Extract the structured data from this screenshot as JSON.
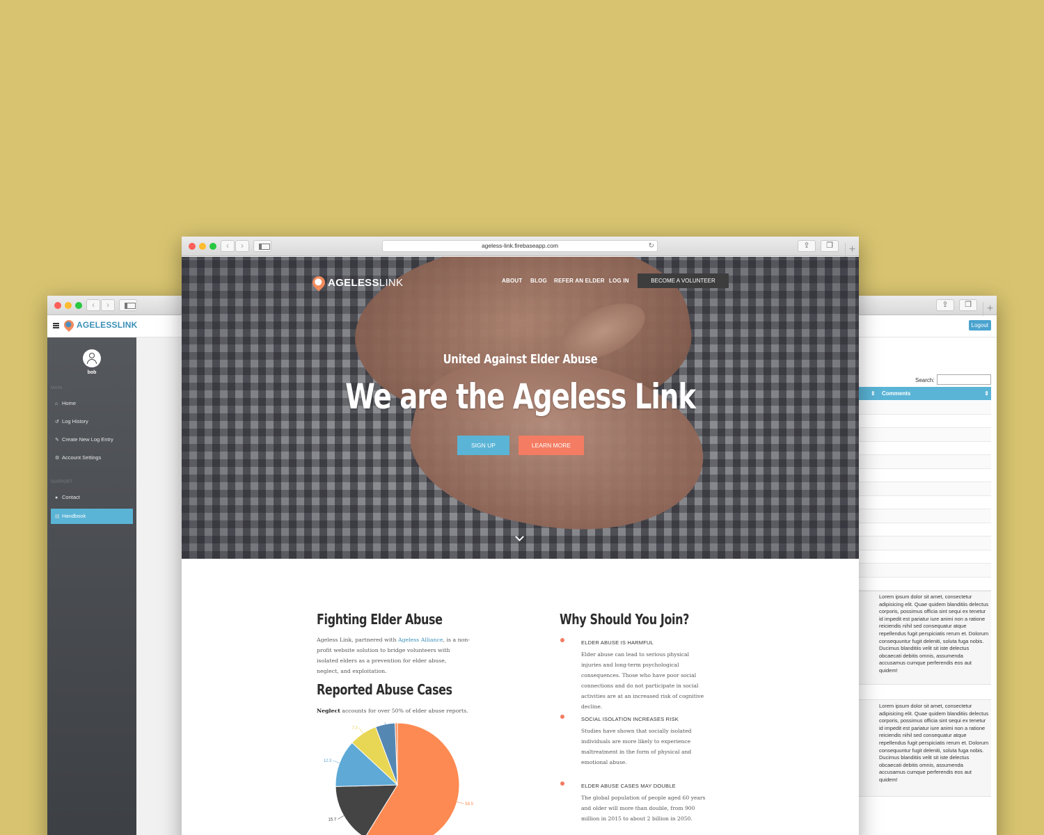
{
  "dashboard": {
    "logo_text": "AGELESSLINK",
    "username": "bob",
    "section_main": "MAIN",
    "section_support": "SUPPORT",
    "nav_main": [
      {
        "label": "Home",
        "icon": "home-icon"
      },
      {
        "label": "Log History",
        "icon": "history-icon"
      },
      {
        "label": "Create New Log Entry",
        "icon": "pencil-icon"
      },
      {
        "label": "Account Settings",
        "icon": "gears-icon"
      }
    ],
    "nav_support": [
      {
        "label": "Contact",
        "icon": "user-icon"
      },
      {
        "label": "Handbook",
        "icon": "book-icon",
        "active": true
      }
    ],
    "accent_color": "#5ab4d6"
  },
  "table_page": {
    "logout_label": "Logout",
    "search_label": "Search:",
    "column_header": "Comments",
    "comments": [
      "Lorem ipsum dolor sit amet, consectetur adipisicing elit. Quae quidem blanditiis delectus corporis, possimus officia sint sequi ex tenetur id impedit est pariatur iure animi non a ratione reiciendis nihil sed consequatur atque repellendus fugit perspiciatis rerum et. Dolorum consequuntur fugit deleniti, soluta fuga nobis. Ducimus blanditiis velit sit iste delectus obcaecati debitis omnis, assumenda accusamus cumque perferendis eos aut quidem!",
      "Lorem ipsum dolor sit amet, consectetur adipisicing elit. Quae quidem blanditiis delectus corporis, possimus officia sint sequi ex tenetur id impedit est pariatur iure animi non a ratione reiciendis nihil sed consequatur atque repellendus fugit perspiciatis rerum et. Dolorum consequuntur fugit deleniti, soluta fuga nobis. Ducimus blanditiis velit sit iste delectus obcaecati debitis omnis, assumenda accusamus cumque perferendis eos aut quidem!"
    ]
  },
  "browser": {
    "url": "ageless-link.firebaseapp.com"
  },
  "site": {
    "brand_bold": "AGELESS",
    "brand_thin": "LINK",
    "nav": [
      "ABOUT",
      "BLOG",
      "REFER AN ELDER",
      "LOG IN"
    ],
    "volunteer_button": "BECOME A VOLUNTEER",
    "hero_subtitle": "United Against Elder Abuse",
    "hero_title": "We are the Ageless Link",
    "signup_button": "SIGN UP",
    "learn_button": "LEARN MORE",
    "fighting_heading": "Fighting Elder Abuse",
    "fighting_text_1": "Ageless Link, partnered with ",
    "fighting_link": "Ageless Alliance",
    "fighting_text_2": ", is a non-profit website solution to bridge volunteers with isolated elders as a prevention for elder abuse, neglect, and exploitation.",
    "cases_heading": "Reported Abuse Cases",
    "cases_bold": "Neglect",
    "cases_text": " accounts for over 50% of elder abuse reports.",
    "why_heading": "Why Should You Join?",
    "why_items": [
      {
        "title": "ELDER ABUSE IS HARMFUL",
        "text": "Elder abuse can lead to serious physical injuries and long-term psychological consequences. Those who have poor social connections and do not participate in social activities are at an increased risk of cognitive decline."
      },
      {
        "title": "SOCIAL ISOLATION INCREASES RISK",
        "text": "Studies have shown that socially isolated individuals are more likely to experience maltreatment in the form of physical and emotional abuse."
      },
      {
        "title": "ELDER ABUSE CASES MAY DOUBLE",
        "text": "The global population of people aged 60 years and older will more than double, from 900 million in 2015 to about 2 billion in 2050."
      }
    ],
    "bullet_color": "#f47c62"
  },
  "chart_data": {
    "type": "pie",
    "values": [
      58.5,
      15.7,
      12.3,
      7.3,
      5.1,
      0.6
    ],
    "labels": [
      "58.5",
      "15.7",
      "12.3",
      "7.3",
      "5.1",
      "0.6"
    ],
    "colors": [
      "#fd8a52",
      "#444444",
      "#5ea9d6",
      "#e8d655",
      "#5587b3",
      "#fd8a52"
    ]
  }
}
